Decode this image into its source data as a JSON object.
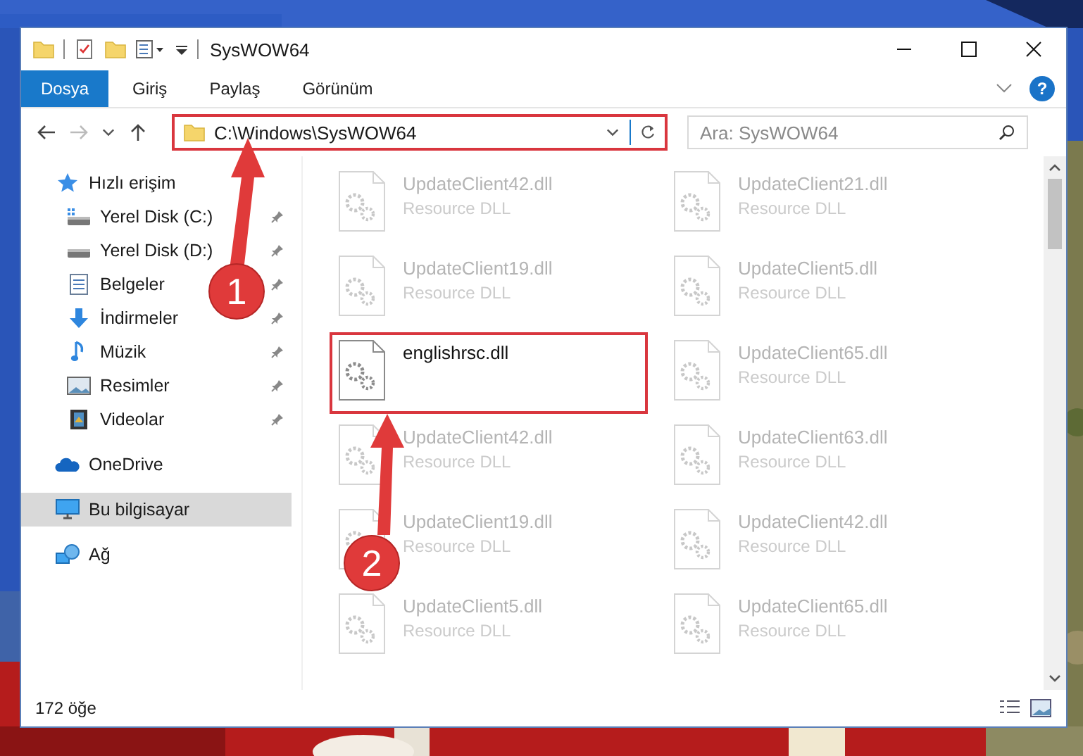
{
  "window": {
    "title": "SysWOW64"
  },
  "ribbon_tabs": [
    {
      "label": "Dosya",
      "kind": "file"
    },
    {
      "label": "Giriş",
      "kind": "tab"
    },
    {
      "label": "Paylaş",
      "kind": "tab"
    },
    {
      "label": "Görünüm",
      "kind": "tab"
    }
  ],
  "help": "?",
  "address": {
    "value": "C:\\Windows\\SysWOW64",
    "highlighted": true
  },
  "search": {
    "placeholder": "Ara: SysWOW64"
  },
  "navigation": [
    {
      "label": "Hızlı erişim",
      "kind": "star",
      "selected": false,
      "children": [
        {
          "label": "Yerel Disk (C:)",
          "kind": "system-drive",
          "pinned": true
        },
        {
          "label": "Yerel Disk (D:)",
          "kind": "drive",
          "pinned": true
        },
        {
          "label": "Belgeler",
          "kind": "documents",
          "pinned": true
        },
        {
          "label": "İndirmeler",
          "kind": "downloads",
          "pinned": true
        },
        {
          "label": "Müzik",
          "kind": "music",
          "pinned": true
        },
        {
          "label": "Resimler",
          "kind": "pictures",
          "pinned": true
        },
        {
          "label": "Videolar",
          "kind": "videos",
          "pinned": true
        }
      ]
    },
    {
      "label": "OneDrive",
      "kind": "cloud",
      "selected": false
    },
    {
      "label": "Bu bilgisayar",
      "kind": "computer",
      "selected": true
    },
    {
      "label": "Ağ",
      "kind": "network",
      "selected": false
    }
  ],
  "files": [
    {
      "name": "UpdateClient42.dll",
      "type": "Resource DLL",
      "dimmed": true,
      "highlighted": false
    },
    {
      "name": "UpdateClient21.dll",
      "type": "Resource DLL",
      "dimmed": true,
      "highlighted": false
    },
    {
      "name": "UpdateClient19.dll",
      "type": "Resource DLL",
      "dimmed": true,
      "highlighted": false
    },
    {
      "name": "UpdateClient5.dll",
      "type": "Resource DLL",
      "dimmed": true,
      "highlighted": false
    },
    {
      "name": "englishrsc.dll",
      "dimmed": false,
      "highlighted": true
    },
    {
      "name": "UpdateClient65.dll",
      "type": "Resource DLL",
      "dimmed": true,
      "highlighted": false
    },
    {
      "name": "UpdateClient42.dll",
      "type": "Resource DLL",
      "dimmed": true,
      "highlighted": false
    },
    {
      "name": "UpdateClient63.dll",
      "type": "Resource DLL",
      "dimmed": true,
      "highlighted": false
    },
    {
      "name": "UpdateClient19.dll",
      "type": "Resource DLL",
      "dimmed": true,
      "highlighted": false
    },
    {
      "name": "UpdateClient42.dll",
      "type": "Resource DLL",
      "dimmed": true,
      "highlighted": false
    },
    {
      "name": "UpdateClient5.dll",
      "type": "Resource DLL",
      "dimmed": true,
      "highlighted": false
    },
    {
      "name": "UpdateClient65.dll",
      "type": "Resource DLL",
      "dimmed": true,
      "highlighted": false
    }
  ],
  "status_bar": {
    "item_count": "172 öğe"
  },
  "annotations": [
    {
      "label": "1"
    },
    {
      "label": "2"
    }
  ]
}
